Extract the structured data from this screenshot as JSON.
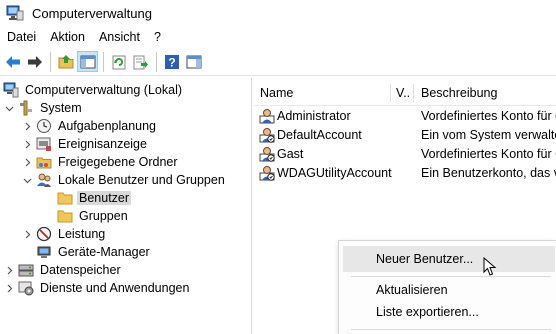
{
  "window": {
    "title": "Computerverwaltung"
  },
  "menu": [
    "Datei",
    "Aktion",
    "Ansicht",
    "?"
  ],
  "toolbar": {
    "buttons": [
      "back-arrow-icon",
      "forward-arrow-icon",
      "up-folder-icon",
      "show-hide-tree-icon",
      "refresh-icon",
      "export-list-icon",
      "help-icon",
      "properties-pane-icon"
    ]
  },
  "tree": {
    "items": [
      {
        "label": "Computerverwaltung (Lokal)",
        "icon": "computer-management-icon"
      },
      {
        "label": "System",
        "icon": "tools-icon",
        "expander": "expanded"
      },
      {
        "label": "Aufgabenplanung",
        "icon": "clock-icon",
        "expander": "collapsed"
      },
      {
        "label": "Ereignisanzeige",
        "icon": "event-viewer-icon",
        "expander": "collapsed"
      },
      {
        "label": "Freigegebene Ordner",
        "icon": "shared-folder-icon",
        "expander": "collapsed"
      },
      {
        "label": "Lokale Benutzer und Gruppen",
        "icon": "users-groups-icon",
        "expander": "expanded"
      },
      {
        "label": "Benutzer",
        "icon": "folder-icon",
        "selected": true
      },
      {
        "label": "Gruppen",
        "icon": "folder-icon"
      },
      {
        "label": "Leistung",
        "icon": "performance-icon",
        "expander": "collapsed"
      },
      {
        "label": "Geräte-Manager",
        "icon": "device-manager-icon"
      },
      {
        "label": "Datenspeicher",
        "icon": "storage-icon",
        "expander": "collapsed"
      },
      {
        "label": "Dienste und Anwendungen",
        "icon": "services-icon",
        "expander": "collapsed"
      }
    ]
  },
  "list": {
    "columns": [
      "Name",
      "V..",
      "Beschreibung"
    ],
    "rows": [
      {
        "name": "Administrator",
        "description": "Vordefiniertes Konto für d"
      },
      {
        "name": "DefaultAccount",
        "description": "Ein vom System verwaltet"
      },
      {
        "name": "Gast",
        "description": "Vordefiniertes Konto für G"
      },
      {
        "name": "WDAGUtilityAccount",
        "description": "Ein Benutzerkonto, das vo"
      }
    ]
  },
  "context_menu": {
    "items": [
      "Neuer Benutzer...",
      "Aktualisieren",
      "Liste exportieren..."
    ]
  },
  "colors": {
    "selection": "#d9d9d9",
    "menu_hover": "#e7e7e7",
    "pressed_button": "#cce4f7"
  }
}
